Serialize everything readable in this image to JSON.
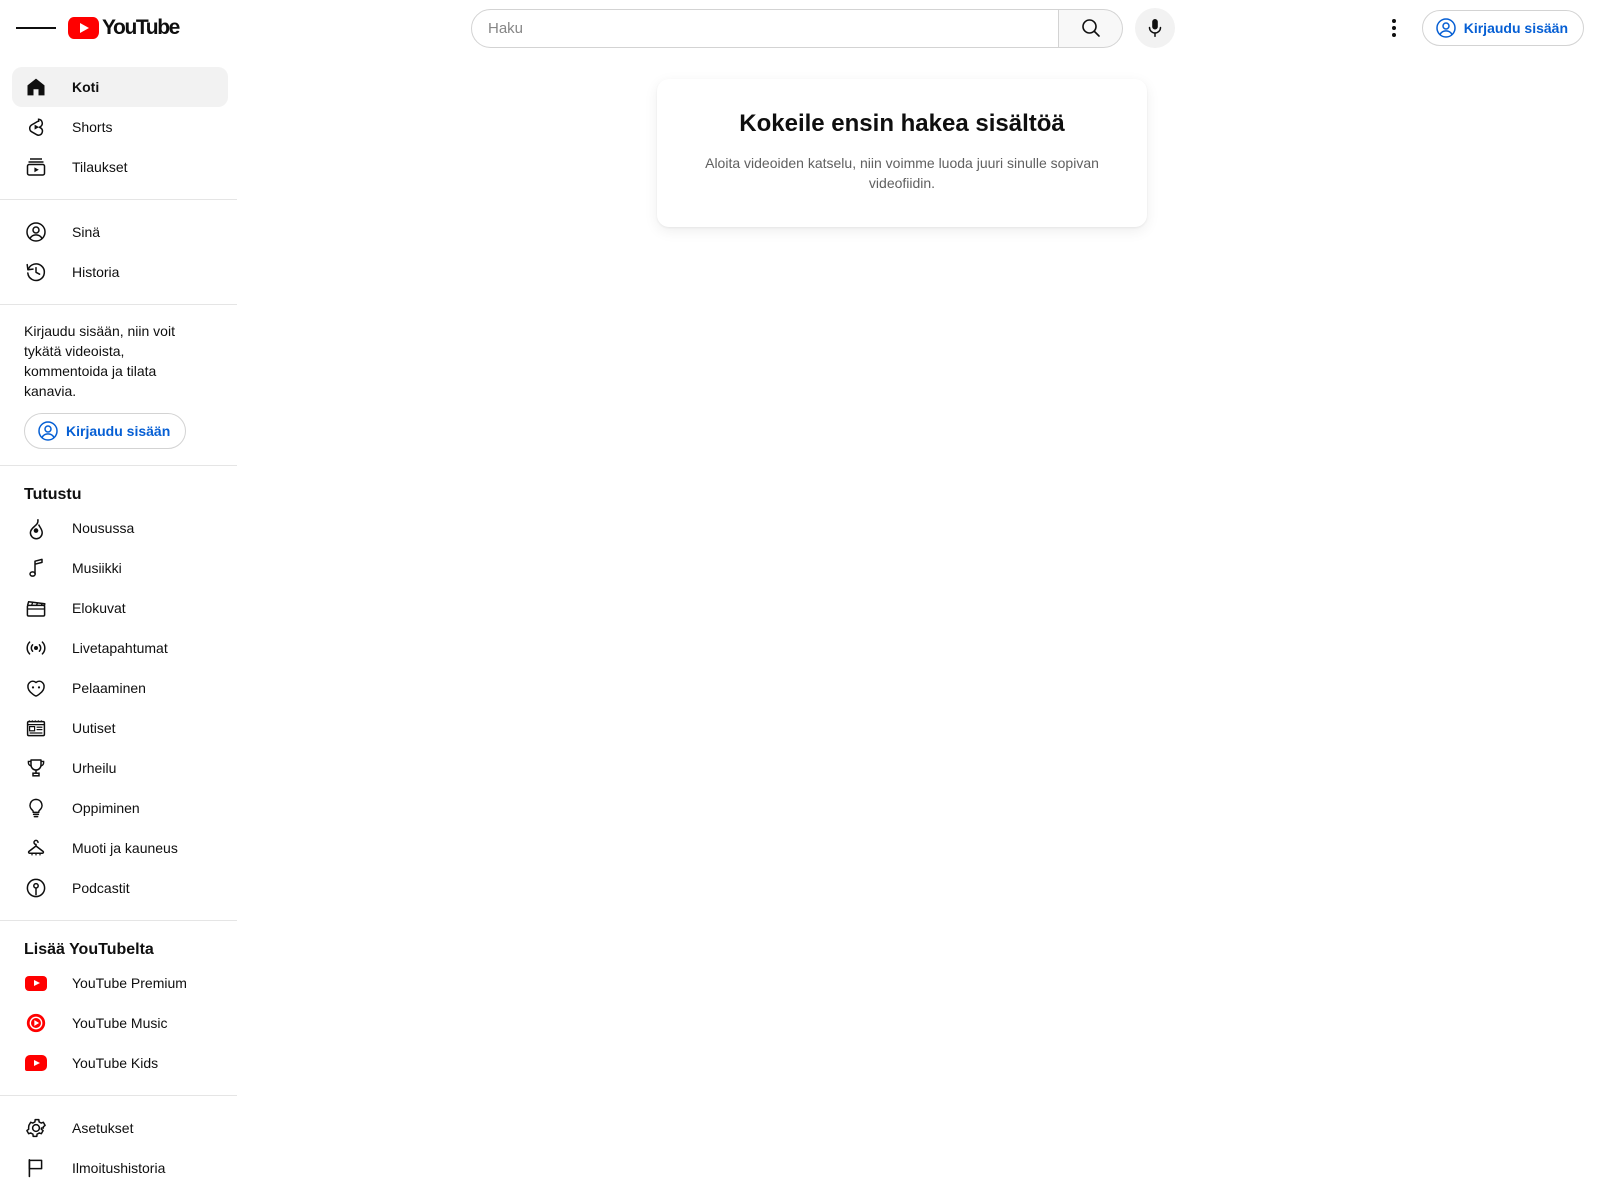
{
  "app": {
    "name": "YouTube"
  },
  "topbar": {
    "menu_icon": "hamburger-icon",
    "logo_text": "YouTube",
    "search_placeholder": "Haku",
    "search_value": "",
    "search_icon": "search-icon",
    "mic_icon": "microphone-icon",
    "kebab_icon": "more-vertical-icon",
    "signin_label": "Kirjaudu sisään",
    "signin_icon": "account-circle-icon"
  },
  "sidebar": {
    "primary": [
      {
        "label": "Koti",
        "icon": "home-icon",
        "active": true
      },
      {
        "label": "Shorts",
        "icon": "shorts-icon",
        "active": false
      },
      {
        "label": "Tilaukset",
        "icon": "subscriptions-icon",
        "active": false
      }
    ],
    "personal": [
      {
        "label": "Sinä",
        "icon": "account-circle-icon",
        "active": false
      },
      {
        "label": "Historia",
        "icon": "history-icon",
        "active": false
      }
    ],
    "signin_prompt": {
      "text": "Kirjaudu sisään, niin voit tykätä videoista, kommentoida ja tilata kanavia.",
      "button_label": "Kirjaudu sisään",
      "button_icon": "account-circle-icon"
    },
    "explore": {
      "title": "Tutustu",
      "items": [
        {
          "label": "Nousussa",
          "icon": "trending-icon"
        },
        {
          "label": "Musiikki",
          "icon": "music-note-icon"
        },
        {
          "label": "Elokuvat",
          "icon": "clapperboard-icon"
        },
        {
          "label": "Livetapahtumat",
          "icon": "live-broadcast-icon"
        },
        {
          "label": "Pelaaminen",
          "icon": "gaming-controller-icon"
        },
        {
          "label": "Uutiset",
          "icon": "newspaper-icon"
        },
        {
          "label": "Urheilu",
          "icon": "trophy-icon"
        },
        {
          "label": "Oppiminen",
          "icon": "lightbulb-icon"
        },
        {
          "label": "Muoti ja kauneus",
          "icon": "hanger-icon"
        },
        {
          "label": "Podcastit",
          "icon": "podcast-icon"
        }
      ]
    },
    "more": {
      "title": "Lisää YouTubelta",
      "items": [
        {
          "label": "YouTube Premium",
          "icon": "youtube-premium-icon"
        },
        {
          "label": "YouTube Music",
          "icon": "youtube-music-icon"
        },
        {
          "label": "YouTube Kids",
          "icon": "youtube-kids-icon"
        }
      ]
    },
    "footer": [
      {
        "label": "Asetukset",
        "icon": "gear-icon"
      },
      {
        "label": "Ilmoitushistoria",
        "icon": "flag-icon"
      }
    ]
  },
  "main": {
    "empty_state": {
      "title": "Kokeile ensin hakea sisältöä",
      "subtitle": "Aloita videoiden katselu, niin voimme luoda juuri sinulle sopivan videofiidin."
    }
  },
  "colors": {
    "brand_red": "#ff0000",
    "link_blue": "#065fd4",
    "text_primary": "#0f0f0f",
    "text_secondary": "#606060",
    "hover_gray": "#f2f2f2",
    "divider": "#e5e5e5"
  }
}
